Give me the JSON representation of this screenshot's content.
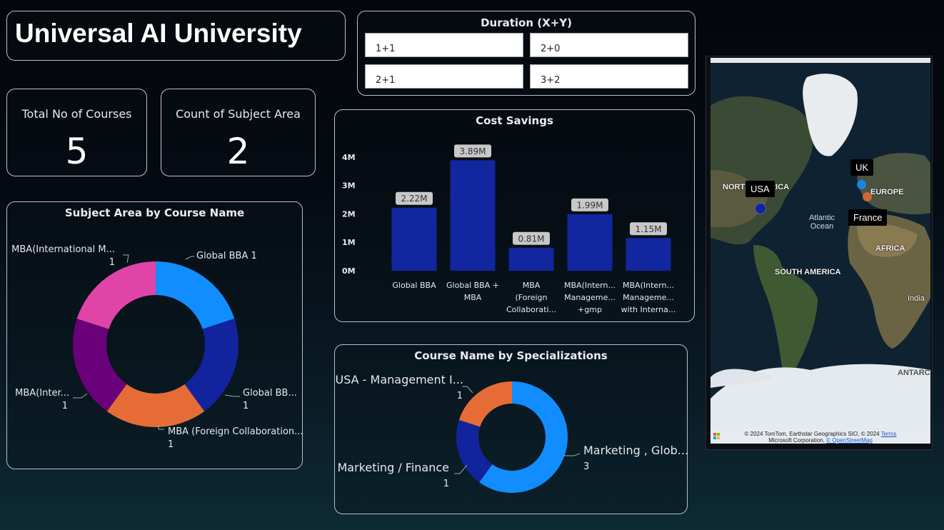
{
  "title": "Universal AI University",
  "kpis": {
    "courses": {
      "label": "Total No of Courses",
      "value": "5"
    },
    "subjects": {
      "label": "Count of Subject Area",
      "value": "2"
    }
  },
  "duration": {
    "title": "Duration (X+Y)",
    "options": [
      "1+1",
      "2+0",
      "2+1",
      "3+2"
    ]
  },
  "cost_savings": {
    "title": "Cost Savings",
    "chart_data": {
      "type": "bar",
      "categories": [
        "Global BBA",
        "Global BBA + MBA",
        "MBA (Foreign Collaborati...",
        "MBA(Intern... Manageme... +gmp",
        "MBA(Intern... Manageme... with Interna..."
      ],
      "category_lines": [
        [
          "Global BBA"
        ],
        [
          "Global BBA +",
          "MBA"
        ],
        [
          "MBA",
          "(Foreign",
          "Collaborati..."
        ],
        [
          "MBA(Intern...",
          "Manageme...",
          "+gmp"
        ],
        [
          "MBA(Intern...",
          "Manageme...",
          "with Interna..."
        ]
      ],
      "values": [
        2.22,
        3.89,
        0.81,
        1.99,
        1.15
      ],
      "data_labels": [
        "2.22M",
        "3.89M",
        "0.81M",
        "1.99M",
        "1.15M"
      ],
      "y_ticks": [
        "0M",
        "1M",
        "2M",
        "3M",
        "4M"
      ],
      "ylim": [
        0,
        4.2
      ],
      "color": "#1226a0"
    }
  },
  "subject_area": {
    "title": "Subject Area by Course Name",
    "chart_data": {
      "type": "pie",
      "donut": true,
      "slices": [
        {
          "name": "Global BBA 1",
          "label": "Global BBA 1",
          "value": 1,
          "color": "#118dff"
        },
        {
          "name": "Global BB...",
          "label": "Global BB...",
          "count": "1",
          "value": 1,
          "color": "#12239e"
        },
        {
          "name": "MBA (Foreign Collaboration...",
          "label": "MBA (Foreign Collaboration...",
          "count": "1",
          "value": 1,
          "color": "#e66c37"
        },
        {
          "name": "MBA(Inter...",
          "label": "MBA(Inter...",
          "count": "1",
          "value": 1,
          "color": "#6b007b"
        },
        {
          "name": "MBA(International M...",
          "label": "MBA(International M...",
          "count": "1",
          "value": 1,
          "color": "#e044a7"
        }
      ]
    }
  },
  "specializations": {
    "title": "Course Name by Specializations",
    "chart_data": {
      "type": "pie",
      "donut": true,
      "slices": [
        {
          "name": "Marketing , Glob...",
          "count": "3",
          "value": 3,
          "color": "#118dff"
        },
        {
          "name": "Marketing / Finance",
          "count": "1",
          "value": 1,
          "color": "#12239e"
        },
        {
          "name": "USA - Management I...",
          "count": "1",
          "value": 1,
          "color": "#e66c37"
        }
      ]
    }
  },
  "map": {
    "labels": {
      "usa": "USA",
      "uk": "UK",
      "france": "France"
    },
    "regions": {
      "north_america": "NORTH AMERICA",
      "europe": "EUROPE",
      "africa": "AFRICA",
      "south_america": "SOUTH AMERICA",
      "india": "India",
      "antarctica": "ANTARC",
      "atlantic_1": "Atlantic",
      "atlantic_2": "Ocean"
    },
    "attribution_1": "© 2024 TomTom, Earthstar Geographics SIO, © 2024",
    "attribution_terms": "Terms",
    "attribution_2": "Microsoft Corporation,",
    "attribution_osm": "© OpenStreetMap",
    "colors": {
      "usa": "#12239e",
      "uk": "#118dff",
      "france": "#e66c37"
    }
  }
}
